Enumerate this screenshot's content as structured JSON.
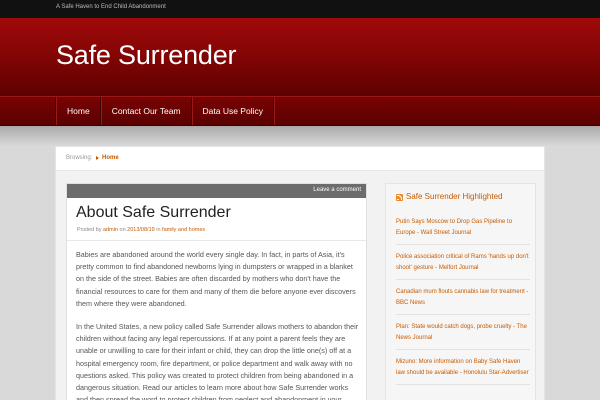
{
  "site": {
    "tagline": "A Safe Haven to End Child Abandonment",
    "title": "Safe Surrender"
  },
  "nav": {
    "items": [
      {
        "label": "Home"
      },
      {
        "label": "Contact Our Team"
      },
      {
        "label": "Data Use Policy"
      }
    ]
  },
  "breadcrumb": {
    "label": "Browsing:",
    "current": "Home"
  },
  "post": {
    "leave_comment": "Leave a comment",
    "title": "About Safe Surrender",
    "meta": {
      "posted_by": "Posted by",
      "author": "admin",
      "on": "on",
      "date": "2013/08/19",
      "in": "in",
      "category": "family and homes"
    },
    "paragraphs": [
      "Babies are abandoned around the world every single day. In fact, in parts of Asia, it's pretty common to find abandoned newborns lying in dumpsters or wrapped in a blanket on the side of the street. Babies are often discarded by mothers who don't have the financial resources to care for them and many of them die before anyone ever discovers them where they were abandoned.",
      "In the United States, a new policy called Safe Surrender allows mothers to abandon their children without facing any legal repercussions. If at any point a parent feels they are unable or unwilling to care for their infant or child, they can drop the little one(s) off at a hospital emergency room, fire department, or police department and walk away with no questions asked. This policy was created to protect children from being abandoned in a dangerous situation. Read our articles to learn more about how Safe Surrender works and then spread the word to protect children from neglect and abandonment in your"
    ]
  },
  "sidebar": {
    "widget_title": "Safe Surrender Highlighted",
    "feed_items": [
      "Putin Says Moscow to Drop Gas Pipeline to Europe - Wall Street Journal",
      "Police association critical of Rams 'hands up don't shoot' gesture - Melfort Journal",
      "Canadian mum flouts cannabis law for treatment - BBC News",
      "Plan: State would catch dogs, probe cruelty - The News Journal",
      "Mizuno: More information on Baby Safe Haven law should be available - Honolulu Star-Advertiser"
    ]
  },
  "colors": {
    "header_red": "#8b0505",
    "accent_orange": "#c75a00",
    "post_bar_gray": "#6c6c6c"
  },
  "icons": {
    "breadcrumb_arrow": "triangle-right-icon",
    "rss": "rss-icon"
  }
}
